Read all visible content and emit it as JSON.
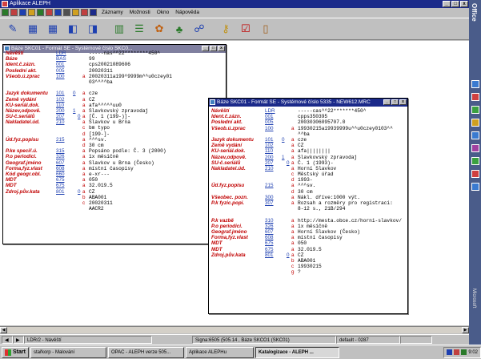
{
  "app": {
    "title": "Aplikace ALEPH"
  },
  "menu": [
    "Záznamy",
    "Možnosti",
    "Okno",
    "Nápověda"
  ],
  "colors": {
    "accent": "#1b2a8a",
    "field_label": "#c00000",
    "field_code": "#1d3fb0"
  },
  "toolbar_icons": [
    {
      "name": "search-icon",
      "glyph": "✎",
      "color": "#1d3fb0"
    },
    {
      "name": "save-icon",
      "glyph": "▦",
      "color": "#1d3fb0"
    },
    {
      "name": "open-record-icon",
      "glyph": "▦",
      "color": "#1d3fb0"
    },
    {
      "name": "copy-icon",
      "glyph": "◧",
      "color": "#1d3fb0"
    },
    {
      "name": "new-record-icon",
      "glyph": "◨",
      "color": "#1d3fb0"
    },
    {
      "name": "form-icon",
      "glyph": "▥",
      "color": "#2a7a2a"
    },
    {
      "name": "list-icon",
      "glyph": "☰",
      "color": "#2a7a2a"
    },
    {
      "name": "settings-icon",
      "glyph": "✿",
      "color": "#c06010"
    },
    {
      "name": "tree-icon",
      "glyph": "♣",
      "color": "#2a7a2a"
    },
    {
      "name": "binoculars-icon",
      "glyph": "☍",
      "color": "#1d3fb0"
    },
    {
      "name": "key-icon",
      "glyph": "⚷",
      "color": "#c09010"
    },
    {
      "name": "check-icon",
      "glyph": "☑",
      "color": "#c00000"
    },
    {
      "name": "exit-icon",
      "glyph": "▯",
      "color": "#a06020"
    }
  ],
  "window1": {
    "title": "Báze SKC01 - Formát SE - Systémové číslo SKC0...",
    "rows": [
      {
        "label": "Návěští",
        "code": "LDR",
        "i1": "",
        "i2": "",
        "sub": "",
        "value": "-----nas^^22********450^"
      },
      {
        "label": "Báze",
        "code": "BAS",
        "i1": "",
        "i2": "",
        "sub": "",
        "value": "99"
      },
      {
        "label": "Ident.č.zázn.",
        "code": "001",
        "i1": "",
        "i2": "",
        "sub": "",
        "value": "cps20021089606"
      },
      {
        "label": "Poslední akt.",
        "code": "005",
        "i1": "",
        "i2": "",
        "sub": "",
        "value": "20020311"
      },
      {
        "label": "Všeob.ú.zprac",
        "code": "100",
        "i1": "",
        "i2": "",
        "sub": "a",
        "value": "20020311a199^9999m^^u0czey01"
      },
      {
        "label": "",
        "code": "",
        "i1": "",
        "i2": "",
        "sub": "",
        "value": "03^^^^ba"
      },
      {
        "label": "",
        "code": "",
        "i1": "",
        "i2": "",
        "sub": "",
        "value": ""
      },
      {
        "label": "Jazyk dokumentu",
        "code": "101",
        "i1": "0",
        "i2": "",
        "sub": "a",
        "value": "cze"
      },
      {
        "label": "Země vydání",
        "code": "102",
        "i1": "",
        "i2": "",
        "sub": "a",
        "value": "CZ"
      },
      {
        "label": "KU-seriál.dok.",
        "code": "110",
        "i1": "",
        "i2": "",
        "sub": "a",
        "value": "afa^^^^^uu0"
      },
      {
        "label": "Název,odpově.",
        "code": "200",
        "i1": "1",
        "i2": "",
        "sub": "a",
        "value": "Slavkovský zpravodaj"
      },
      {
        "label": "SU-č.seriálů",
        "code": "207",
        "i1": "",
        "i2": "0",
        "sub": "a",
        "value": "[Č. 1 (199-)]-"
      },
      {
        "label": "Nakladatel.úd.",
        "code": "210",
        "i1": "",
        "i2": "",
        "sub": "a",
        "value": "Slavkov u Brna"
      },
      {
        "label": "",
        "code": "",
        "i1": "",
        "i2": "",
        "sub": "c",
        "value": "bm typo"
      },
      {
        "label": "",
        "code": "",
        "i1": "",
        "i2": "",
        "sub": "d",
        "value": "[199-]-"
      },
      {
        "label": "Úd.fyz.popisu",
        "code": "215",
        "i1": "",
        "i2": "",
        "sub": "a",
        "value": "^^^sv."
      },
      {
        "label": "",
        "code": "",
        "i1": "",
        "i2": "",
        "sub": "d",
        "value": "30 cm"
      },
      {
        "label": "P.ke speciř.ú.",
        "code": "315",
        "i1": "",
        "i2": "",
        "sub": "a",
        "value": "Popsáno podle: Č. 3 (2000)"
      },
      {
        "label": "P.o periodici.",
        "code": "326",
        "i1": "",
        "i2": "",
        "sub": "a",
        "value": "1x měsíčně"
      },
      {
        "label": "Geograf.jméno",
        "code": "607",
        "i1": "",
        "i2": "",
        "sub": "a",
        "value": "Slavkov u Brna (Česko)"
      },
      {
        "label": "Forma,fyz.vlast",
        "code": "608",
        "i1": "",
        "i2": "",
        "sub": "a",
        "value": "místní časopisy"
      },
      {
        "label": "Kód geogr.obl.",
        "code": "660",
        "i1": "",
        "i2": "",
        "sub": "a",
        "value": "e-xr---"
      },
      {
        "label": "MDT",
        "code": "675",
        "i1": "",
        "i2": "",
        "sub": "a",
        "value": "050"
      },
      {
        "label": "MDT",
        "code": "675",
        "i1": "",
        "i2": "",
        "sub": "a",
        "value": "32.019.5"
      },
      {
        "label": "Zdroj.pův.kata",
        "code": "801",
        "i1": "",
        "i2": "0",
        "sub": "a",
        "value": "CZ"
      },
      {
        "label": "",
        "code": "",
        "i1": "",
        "i2": "",
        "sub": "b",
        "value": "ABA001"
      },
      {
        "label": "",
        "code": "",
        "i1": "",
        "i2": "",
        "sub": "c",
        "value": "20020311"
      },
      {
        "label": "",
        "code": "",
        "i1": "",
        "i2": "",
        "sub": "",
        "value": "AACR2"
      }
    ]
  },
  "window2": {
    "title": "Báze SKC01 - Formát SE - Systémové číslo 5335 - NEW612.MRC",
    "rows": [
      {
        "label": "Návěští",
        "code": "LDR",
        "i1": "",
        "i2": "",
        "sub": "",
        "value": "-----cas^^22*******450^"
      },
      {
        "label": "Ident.č.zázn.",
        "code": "001",
        "i1": "",
        "i2": "",
        "sub": "",
        "value": "cpps350395"
      },
      {
        "label": "Poslední akt.",
        "code": "005",
        "i1": "",
        "i2": "",
        "sub": "",
        "value": "20030306095707.0"
      },
      {
        "label": "Všeob.ú.zprac",
        "code": "100",
        "i1": "",
        "i2": "",
        "sub": "a",
        "value": "19930215a19939999u^^u0czey0103^^"
      },
      {
        "label": "",
        "code": "",
        "i1": "",
        "i2": "",
        "sub": "",
        "value": "^^ba"
      },
      {
        "label": "Jazyk dokumentu",
        "code": "101",
        "i1": "0",
        "i2": "",
        "sub": "a",
        "value": "cze"
      },
      {
        "label": "Země vydání",
        "code": "102",
        "i1": "",
        "i2": "",
        "sub": "a",
        "value": "CZ"
      },
      {
        "label": "KU-seriál.dok.",
        "code": "110",
        "i1": "",
        "i2": "",
        "sub": "a",
        "value": "afa||||||||"
      },
      {
        "label": "Název,odpově.",
        "code": "200",
        "i1": "1",
        "i2": "",
        "sub": "a",
        "value": "Slavkovský zpravodaj"
      },
      {
        "label": "SU-č.seriálů",
        "code": "207",
        "i1": "",
        "i2": "0",
        "sub": "a",
        "value": "Č. 1 (1993)-"
      },
      {
        "label": "Nakladatel.úd.",
        "code": "210",
        "i1": "",
        "i2": "",
        "sub": "a",
        "value": "Horní Slavkov"
      },
      {
        "label": "",
        "code": "",
        "i1": "",
        "i2": "",
        "sub": "c",
        "value": "Městský úřad"
      },
      {
        "label": "",
        "code": "",
        "i1": "",
        "i2": "",
        "sub": "d",
        "value": "1993-"
      },
      {
        "label": "Úd.fyz.popisu",
        "code": "215",
        "i1": "",
        "i2": "",
        "sub": "a",
        "value": "^^^sv."
      },
      {
        "label": "",
        "code": "",
        "i1": "",
        "i2": "",
        "sub": "d",
        "value": "30 cm"
      },
      {
        "label": "Všeobec. pozn.",
        "code": "300",
        "i1": "",
        "i2": "",
        "sub": "a",
        "value": "Nákl. dříve:1000 výt."
      },
      {
        "label": "P.k fyzic.popi.",
        "code": "307",
        "i1": "",
        "i2": "",
        "sub": "a",
        "value": "Rozsah a rozměry pro registraci:"
      },
      {
        "label": "",
        "code": "",
        "i1": "",
        "i2": "",
        "sub": "",
        "value": "8-12 s., 21B/294"
      },
      {
        "label": "",
        "code": "",
        "i1": "",
        "i2": "",
        "sub": "",
        "value": ""
      },
      {
        "label": "P.k vazbě",
        "code": "310",
        "i1": "",
        "i2": "",
        "sub": "a",
        "value": "http://mesta.obce.cz/horni-slavkov/"
      },
      {
        "label": "P.o periodici.",
        "code": "326",
        "i1": "",
        "i2": "",
        "sub": "a",
        "value": "1x měsíčně"
      },
      {
        "label": "Geograf.jméno",
        "code": "607",
        "i1": "",
        "i2": "",
        "sub": "a",
        "value": "Horní Slavkov (Česko)"
      },
      {
        "label": "Forma,fyz.vlast",
        "code": "608",
        "i1": "",
        "i2": "",
        "sub": "a",
        "value": "místní časopisy"
      },
      {
        "label": "MDT",
        "code": "675",
        "i1": "",
        "i2": "",
        "sub": "a",
        "value": "050"
      },
      {
        "label": "MDT",
        "code": "675",
        "i1": "",
        "i2": "",
        "sub": "a",
        "value": "32.019.5"
      },
      {
        "label": "Zdroj.pův.kata",
        "code": "801",
        "i1": "",
        "i2": "0",
        "sub": "a",
        "value": "CZ"
      },
      {
        "label": "",
        "code": "",
        "i1": "",
        "i2": "",
        "sub": "b",
        "value": "ABA001"
      },
      {
        "label": "",
        "code": "",
        "i1": "",
        "i2": "",
        "sub": "c",
        "value": "19930215"
      },
      {
        "label": "",
        "code": "",
        "i1": "",
        "i2": "",
        "sub": "g",
        "value": "?"
      }
    ]
  },
  "statusbar": {
    "left": "LDR/2 - Návěští",
    "middle": "Signa:6505 (505.14 , Báze SKCO1 (SKC01)",
    "right": "default - 0287"
  },
  "taskbar": {
    "start": "Start",
    "items": [
      "stařkorp - Malování",
      "OPAC - ALEPH verze 505...",
      "Aplikace ALEPHu",
      "Katalogizace - ALEPH ..."
    ],
    "clock": "9:02"
  },
  "office": {
    "label": "Office",
    "footer": "Microsoft"
  }
}
